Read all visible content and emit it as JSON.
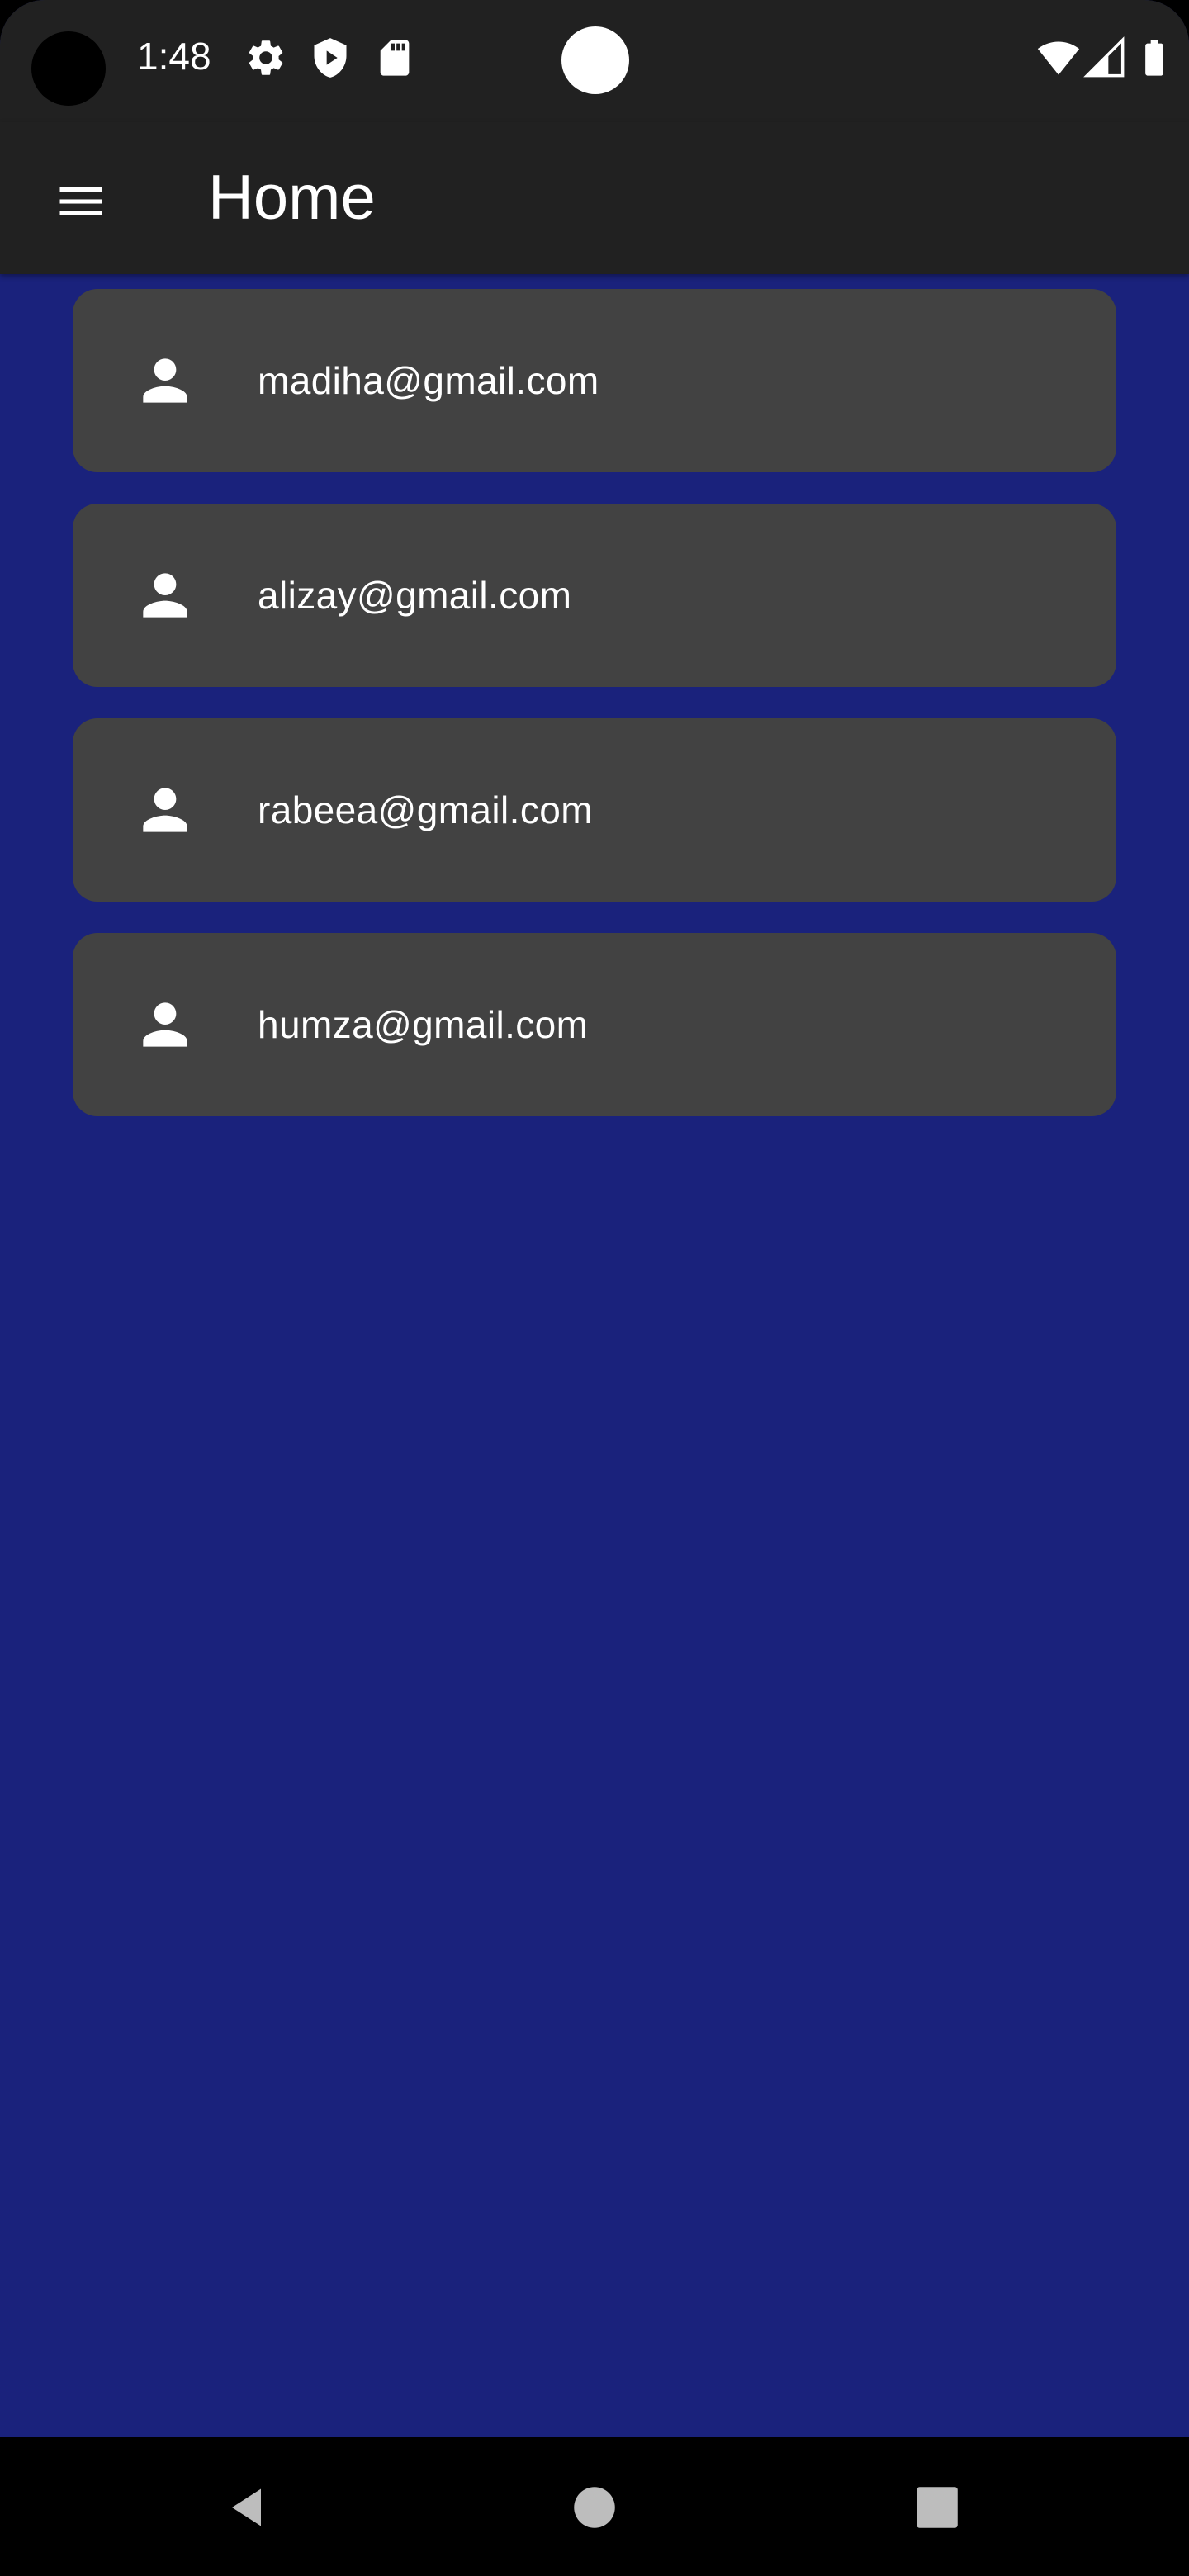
{
  "status_bar": {
    "time": "1:48",
    "icons": [
      "settings-icon",
      "shield-play-icon",
      "sd-card-icon",
      "wifi-icon",
      "signal-icon",
      "battery-icon"
    ]
  },
  "app_bar": {
    "menu_icon": "menu-icon",
    "title": "Home"
  },
  "users": [
    {
      "icon": "person-icon",
      "email": "madiha@gmail.com"
    },
    {
      "icon": "person-icon",
      "email": "alizay@gmail.com"
    },
    {
      "icon": "person-icon",
      "email": "rabeea@gmail.com"
    },
    {
      "icon": "person-icon",
      "email": "humza@gmail.com"
    }
  ],
  "nav_bar": {
    "buttons": [
      "back-icon",
      "home-icon",
      "recents-icon"
    ]
  },
  "colors": {
    "background": "#1a227c",
    "app_bar": "#212121",
    "card": "#424242",
    "text": "#ffffff"
  }
}
